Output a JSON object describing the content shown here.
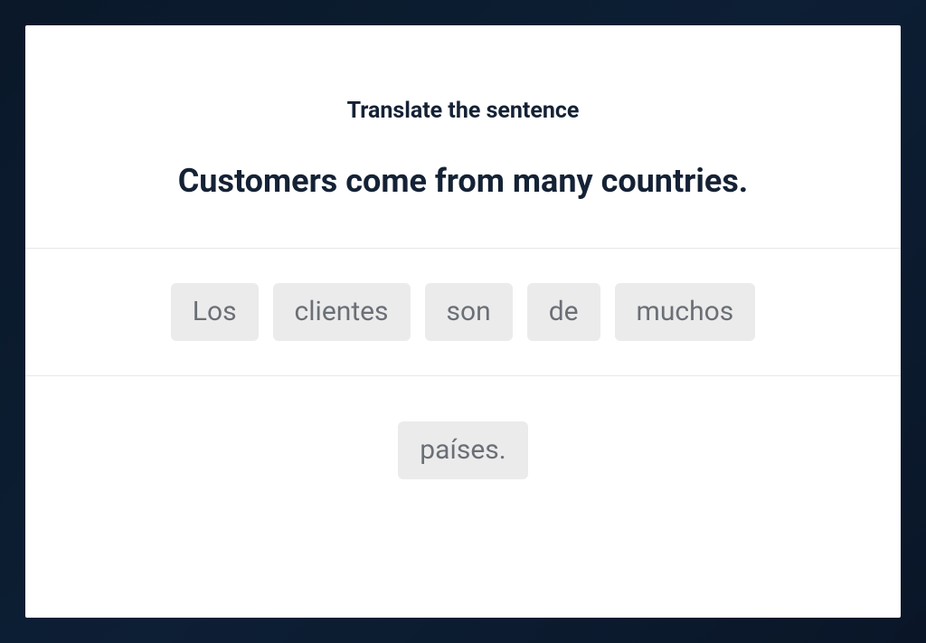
{
  "exercise": {
    "instruction": "Translate the sentence",
    "sentence": "Customers come from many countries.",
    "answer_words": [
      "Los",
      "clientes",
      "son",
      "de",
      "muchos"
    ],
    "bank_words": [
      "países."
    ]
  }
}
